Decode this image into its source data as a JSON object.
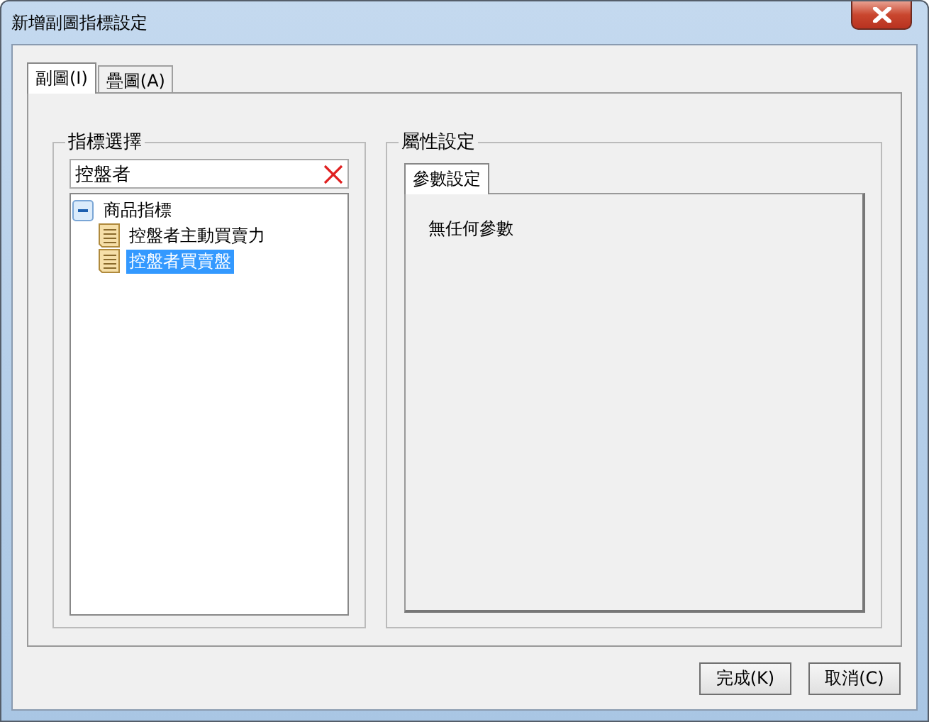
{
  "window": {
    "title": "新增副圖指標設定"
  },
  "tabs": [
    {
      "label": "副圖(I)",
      "selected": true
    },
    {
      "label": "疊圖(A)",
      "selected": false
    }
  ],
  "indicator_group": {
    "title": "指標選擇",
    "search": {
      "value": "控盤者"
    },
    "tree": [
      {
        "label": "商品指標",
        "expanded": true,
        "selected": false,
        "children": [
          {
            "label": "控盤者主動買賣力",
            "selected": false
          },
          {
            "label": "控盤者買賣盤",
            "selected": true
          }
        ]
      }
    ]
  },
  "property_group": {
    "title": "屬性設定",
    "tabs": [
      {
        "label": "參數設定",
        "selected": true
      }
    ],
    "message": "無任何參數"
  },
  "buttons": [
    {
      "label": "完成(K)"
    },
    {
      "label": "取消(C)"
    }
  ]
}
